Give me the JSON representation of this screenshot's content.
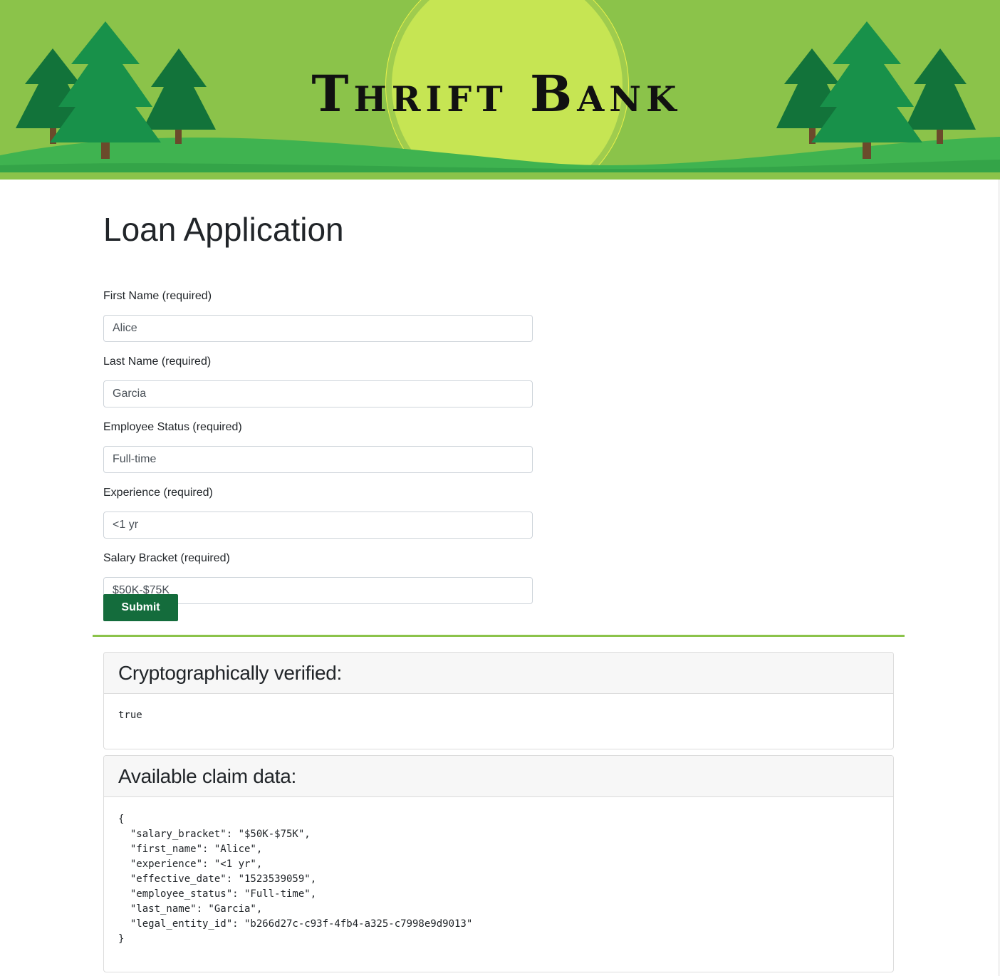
{
  "banner": {
    "title": "Thrift Bank",
    "colors": {
      "sky": "#8bc34a",
      "sun": "#c6e553",
      "hills": "#3fb350",
      "trees": "#18914a"
    }
  },
  "page": {
    "title": "Loan Application"
  },
  "form": {
    "fields": [
      {
        "label": "First Name (required)",
        "value": "Alice"
      },
      {
        "label": "Last Name (required)",
        "value": "Garcia"
      },
      {
        "label": "Employee Status (required)",
        "value": "Full-time"
      },
      {
        "label": "Experience (required)",
        "value": "<1 yr"
      },
      {
        "label": "Salary Bracket (required)",
        "value": "$50K-$75K"
      }
    ],
    "submit_label": "Submit"
  },
  "verification": {
    "heading": "Cryptographically verified:",
    "value": "true"
  },
  "claims": {
    "heading": "Available claim data:",
    "json_text": "{\n  \"salary_bracket\": \"$50K-$75K\",\n  \"first_name\": \"Alice\",\n  \"experience\": \"<1 yr\",\n  \"effective_date\": \"1523539059\",\n  \"employee_status\": \"Full-time\",\n  \"last_name\": \"Garcia\",\n  \"legal_entity_id\": \"b266d27c-c93f-4fb4-a325-c7998e9d9013\"\n}"
  },
  "colors": {
    "accent": "#8bc34a",
    "button": "#146c3c"
  }
}
